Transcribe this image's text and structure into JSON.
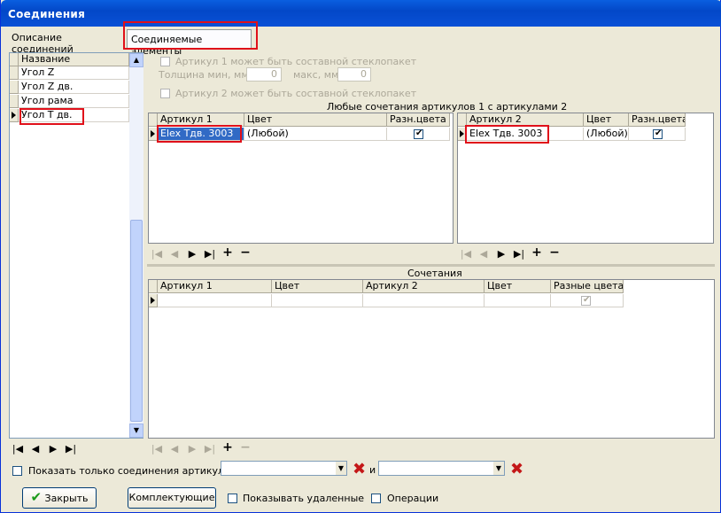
{
  "window": {
    "title": "Соединения"
  },
  "tabs": [
    {
      "label": "Описание соединений"
    },
    {
      "label": "Соединяемые элементы"
    }
  ],
  "left_list": {
    "header": "Название",
    "items": [
      "Угол Z",
      "Угол Z дв.",
      "Угол рама",
      "Угол Т дв."
    ],
    "selected_index": 3
  },
  "options": {
    "art1_composite": "Артикул 1 может быть составной стеклопакет",
    "thickness_min_label": "Толщина мин, мм",
    "thickness_min_value": "0",
    "thickness_max_label": "макс, мм",
    "thickness_max_value": "0",
    "art2_composite": "Артикул 2 может быть составной стеклопакет"
  },
  "combos_section": {
    "title": "Любые сочетания артикулов 1 с артикулами 2"
  },
  "grid1": {
    "columns": [
      "Артикул 1",
      "Цвет",
      "Разн.цвета"
    ],
    "rows": [
      {
        "article": "Elex Тдв. 3003",
        "color": "(Любой)",
        "diff": true
      }
    ]
  },
  "grid2": {
    "columns": [
      "Артикул 2",
      "Цвет",
      "Разн.цвета"
    ],
    "rows": [
      {
        "article": "Elex Тдв. 3003",
        "color": "(Любой)",
        "diff": true
      }
    ]
  },
  "combinations": {
    "title": "Сочетания",
    "columns": [
      "Артикул 1",
      "Цвет",
      "Артикул 2",
      "Цвет",
      "Разные цвета"
    ]
  },
  "nav_glyphs": {
    "first": "|◀",
    "prev": "◀",
    "next": "▶",
    "last": "▶|",
    "add": "+",
    "remove": "−"
  },
  "filter": {
    "label": "Показать только соединения артикулов",
    "and_label": "и"
  },
  "footer": {
    "close": "Закрыть",
    "components": "Комплектующие",
    "show_deleted": "Показывать удаленные",
    "operations": "Операции"
  },
  "colors": {
    "title_bar": "#0a50d6",
    "highlight": "#e0101a",
    "selection": "#316ac5"
  }
}
